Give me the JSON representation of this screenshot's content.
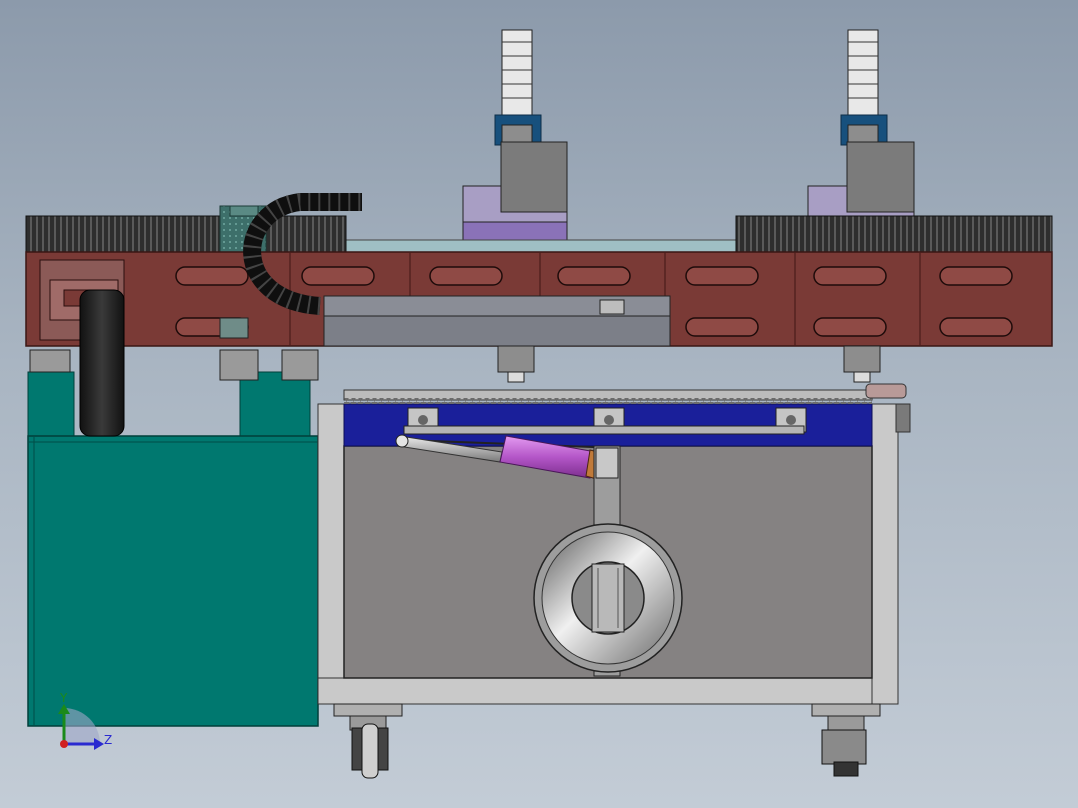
{
  "viewport": {
    "background_top": "#8c9aab",
    "background_bottom": "#c3ccd6"
  },
  "colors": {
    "frame_brown": "#7a3a36",
    "frame_brown_dark": "#5a2522",
    "teal_housing": "#00786f",
    "teal_dark": "#005a54",
    "gray_housing": "#858282",
    "steel_light": "#c9c9c9",
    "blue_rail": "#1a1f9a",
    "purple_block": "#8a72b8",
    "lavender_block": "#a89ec4",
    "magenta_cylinder": "#c86ad8",
    "bellows": "#2b2b2b",
    "cable_chain": "#151515"
  },
  "components": [
    "upper-gantry-frame",
    "left-bellows-cover",
    "right-bellows-cover",
    "cable-drag-chain",
    "left-spindle-head",
    "right-spindle-head",
    "linear-guide-rail",
    "teal-motor-housing",
    "lower-machine-base",
    "pneumatic-cylinder",
    "rotary-fixture-ring",
    "caster-wheel-left",
    "caster-wheel-right"
  ],
  "coordinate_triad": {
    "y_label": "Y",
    "z_label": "Z"
  }
}
